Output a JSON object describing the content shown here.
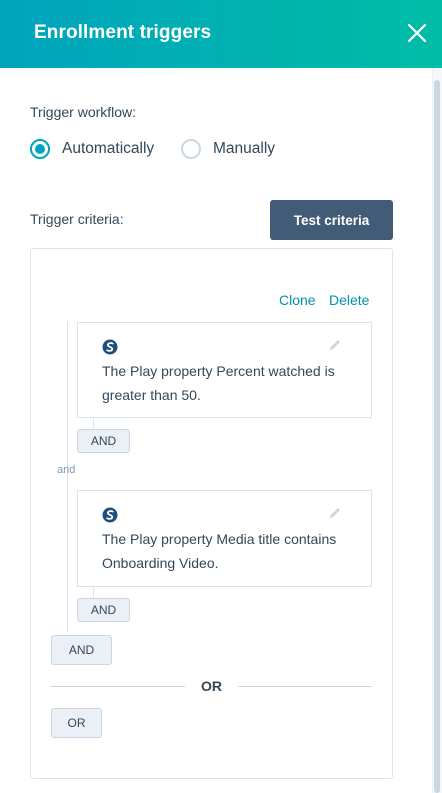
{
  "header": {
    "title": "Enrollment triggers"
  },
  "trigger_workflow": {
    "label": "Trigger workflow:",
    "options": [
      {
        "label": "Automatically",
        "selected": true
      },
      {
        "label": "Manually",
        "selected": false
      }
    ]
  },
  "criteria": {
    "label": "Trigger criteria:",
    "test_button": "Test criteria"
  },
  "group": {
    "clone_label": "Clone",
    "delete_label": "Delete",
    "filters": [
      {
        "icon": "s-logo-icon",
        "prefix": "The Play property",
        "property": "Percent watched",
        "operator": "is greater than",
        "value": "50",
        "end": ".",
        "and_button": "AND"
      },
      {
        "icon": "s-logo-icon",
        "prefix": "The Play property",
        "property": "Media title",
        "operator": "contains",
        "value": "Onboarding Video",
        "end": ".",
        "and_button": "AND"
      }
    ],
    "joiner": "and",
    "group_and_button": "AND"
  },
  "or_divider": "OR",
  "or_button": "OR",
  "colors": {
    "accent": "#00a4bd",
    "button": "#425b76",
    "link": "#0091ae"
  }
}
